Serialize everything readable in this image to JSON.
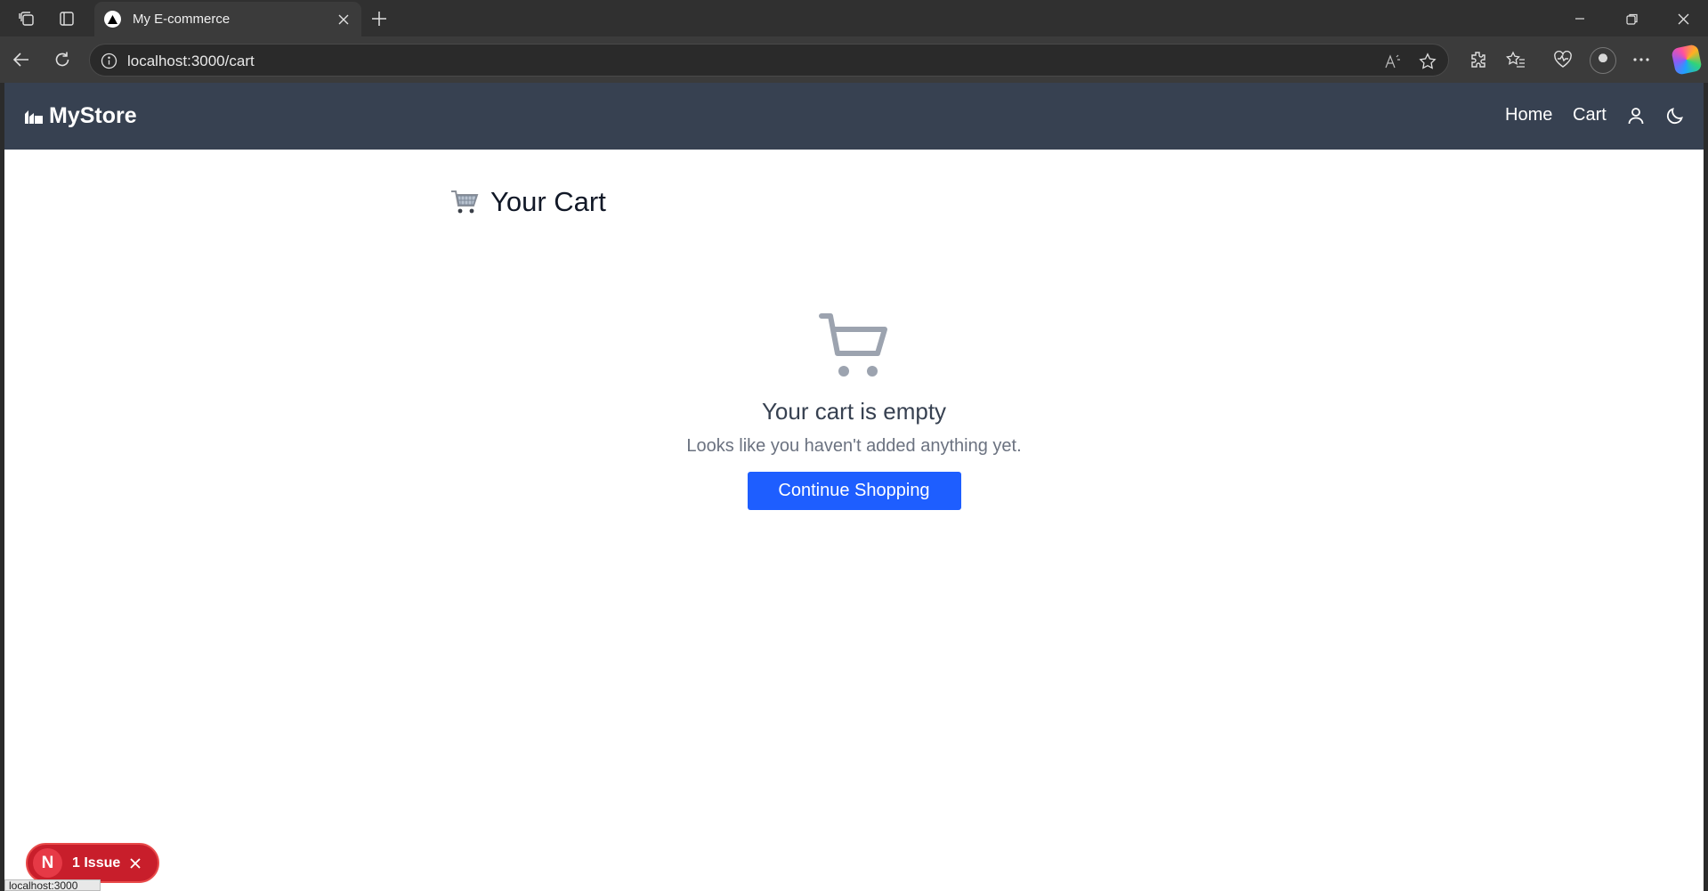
{
  "browser": {
    "tab_title": "My E-commerce",
    "url": "localhost:3000/cart",
    "status_url": "localhost:3000"
  },
  "navbar": {
    "brand": "MyStore",
    "links": [
      {
        "label": "Home"
      },
      {
        "label": "Cart"
      }
    ],
    "icons": [
      "user-icon",
      "moon-icon"
    ],
    "background": "#374151"
  },
  "cart": {
    "heading": "Your Cart",
    "empty_title": "Your cart is empty",
    "empty_subtitle": "Looks like you haven't added anything yet.",
    "cta_label": "Continue Shopping",
    "cta_color": "#1e5eff"
  },
  "dev_overlay": {
    "badge_letter": "N",
    "issues_label": "1 Issue",
    "color": "#c81e2b"
  }
}
